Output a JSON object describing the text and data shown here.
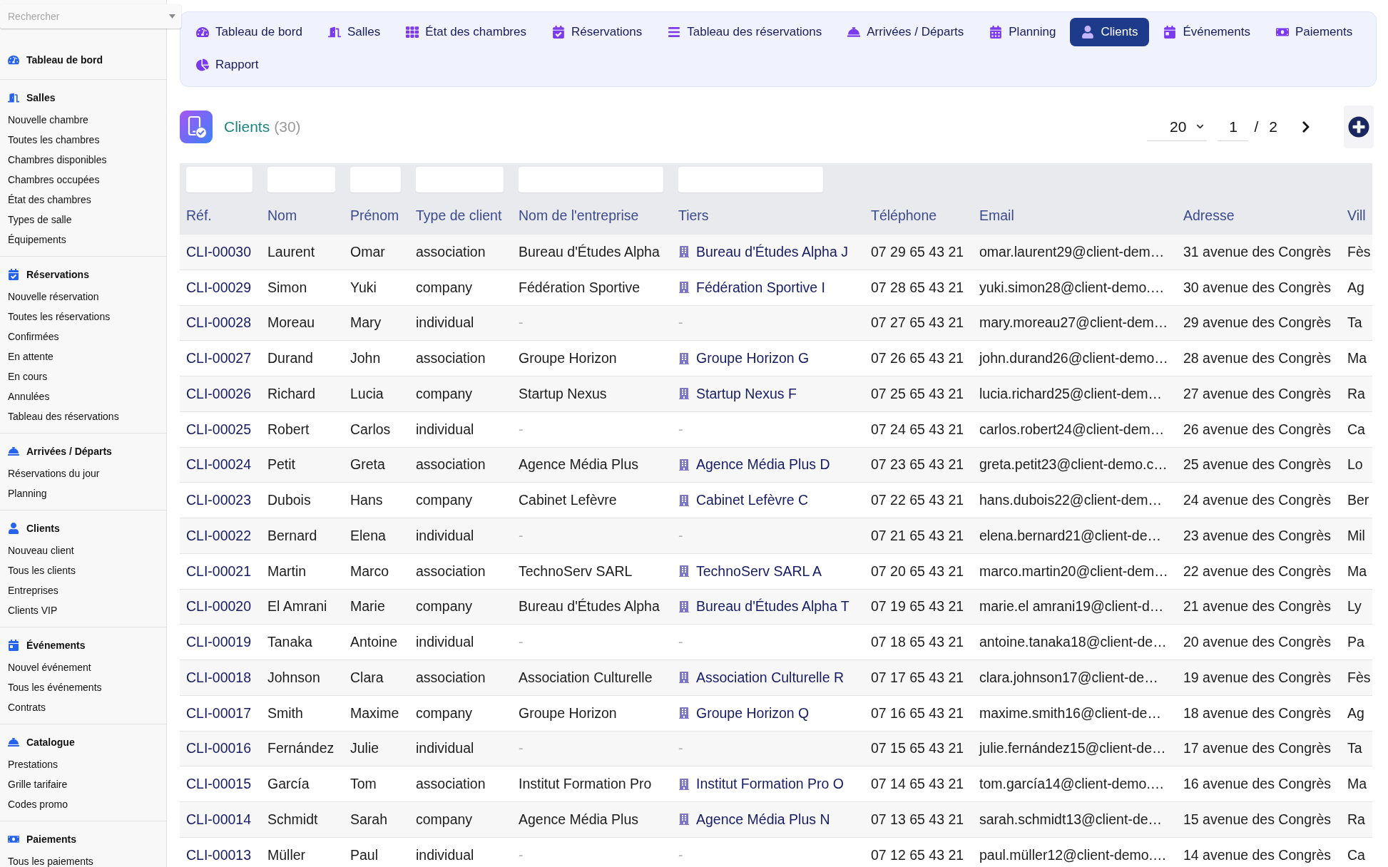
{
  "sidebar": {
    "search": {
      "placeholder": "Rechercher"
    },
    "sections": [
      {
        "title": "Tableau de bord"
      },
      {
        "title": "Salles",
        "items": [
          "Nouvelle chambre",
          "Toutes les chambres",
          "Chambres disponibles",
          "Chambres occupées",
          "État des chambres",
          "Types de salle",
          "Équipements"
        ]
      },
      {
        "title": "Réservations",
        "items": [
          "Nouvelle réservation",
          "Toutes les réservations",
          "Confirmées",
          "En attente",
          "En cours",
          "Annulées",
          "Tableau des réservations"
        ]
      },
      {
        "title": "Arrivées / Départs",
        "items": [
          "Réservations du jour",
          "Planning"
        ]
      },
      {
        "title": "Clients",
        "items": [
          "Nouveau client",
          "Tous les clients",
          "Entreprises",
          "Clients VIP"
        ]
      },
      {
        "title": "Événements",
        "items": [
          "Nouvel événement",
          "Tous les événements",
          "Contrats"
        ]
      },
      {
        "title": "Catalogue",
        "items": [
          "Prestations",
          "Grille tarifaire",
          "Codes promo"
        ]
      },
      {
        "title": "Paiements",
        "items": [
          "Tous les paiements"
        ]
      }
    ]
  },
  "nav": {
    "items": [
      {
        "label": "Tableau de bord",
        "selected": false
      },
      {
        "label": "Salles",
        "selected": false
      },
      {
        "label": "État des chambres",
        "selected": false
      },
      {
        "label": "Réservations",
        "selected": false
      },
      {
        "label": "Tableau des réservations",
        "selected": false
      },
      {
        "label": "Arrivées / Départs",
        "selected": false
      },
      {
        "label": "Planning",
        "selected": false
      },
      {
        "label": "Clients",
        "selected": true
      },
      {
        "label": "Événements",
        "selected": false
      },
      {
        "label": "Paiements",
        "selected": false
      },
      {
        "label": "Rapport",
        "selected": false
      }
    ]
  },
  "header": {
    "title": "Clients",
    "count": "(30)"
  },
  "pagination": {
    "page_size": "20",
    "page": "1",
    "separator": "/",
    "total_pages": "2"
  },
  "table": {
    "columns": [
      {
        "label": "Réf.",
        "filter": true
      },
      {
        "label": "Nom",
        "filter": true
      },
      {
        "label": "Prénom",
        "filter": true
      },
      {
        "label": "Type de client",
        "filter": true
      },
      {
        "label": "Nom de l'entreprise",
        "filter": true
      },
      {
        "label": "Tiers",
        "filter": true
      },
      {
        "label": "Téléphone",
        "filter": false
      },
      {
        "label": "Email",
        "filter": false
      },
      {
        "label": "Adresse",
        "filter": false
      },
      {
        "label": "Vill",
        "filter": false
      }
    ],
    "rows": [
      {
        "ref": "CLI-00030",
        "nom": "Laurent",
        "prenom": "Omar",
        "type_de_client": "association",
        "nom_entreprise": "Bureau d'Études Alpha",
        "tiers": "Bureau d'Études Alpha J",
        "company_linked": true,
        "telephone": "07 29 65 43 21",
        "email": "omar.laurent29@client-dem…",
        "adresse": "31 avenue des Congrès",
        "column_10": "Fès"
      },
      {
        "ref": "CLI-00029",
        "nom": "Simon",
        "prenom": "Yuki",
        "type_de_client": "company",
        "nom_entreprise": "Fédération Sportive",
        "tiers": "Fédération Sportive I",
        "company_linked": true,
        "telephone": "07 28 65 43 21",
        "email": "yuki.simon28@client-demo.…",
        "adresse": "30 avenue des Congrès",
        "column_10": "Ag"
      },
      {
        "ref": "CLI-00028",
        "nom": "Moreau",
        "prenom": "Mary",
        "type_de_client": "individual",
        "nom_entreprise": "-",
        "tiers": "-",
        "company_linked": false,
        "telephone": "07 27 65 43 21",
        "email": "mary.moreau27@client-dem…",
        "adresse": "29 avenue des Congrès",
        "column_10": "Ta"
      },
      {
        "ref": "CLI-00027",
        "nom": "Durand",
        "prenom": "John",
        "type_de_client": "association",
        "nom_entreprise": "Groupe Horizon",
        "tiers": "Groupe Horizon G",
        "company_linked": true,
        "telephone": "07 26 65 43 21",
        "email": "john.durand26@client-demo…",
        "adresse": "28 avenue des Congrès",
        "column_10": "Ma"
      },
      {
        "ref": "CLI-00026",
        "nom": "Richard",
        "prenom": "Lucia",
        "type_de_client": "company",
        "nom_entreprise": "Startup Nexus",
        "tiers": "Startup Nexus F",
        "company_linked": true,
        "telephone": "07 25 65 43 21",
        "email": "lucia.richard25@client-dem…",
        "adresse": "27 avenue des Congrès",
        "column_10": "Ra"
      },
      {
        "ref": "CLI-00025",
        "nom": "Robert",
        "prenom": "Carlos",
        "type_de_client": "individual",
        "nom_entreprise": "-",
        "tiers": "-",
        "company_linked": false,
        "telephone": "07 24 65 43 21",
        "email": "carlos.robert24@client-dem…",
        "adresse": "26 avenue des Congrès",
        "column_10": "Ca"
      },
      {
        "ref": "CLI-00024",
        "nom": "Petit",
        "prenom": "Greta",
        "type_de_client": "association",
        "nom_entreprise": "Agence Média Plus",
        "tiers": "Agence Média Plus D",
        "company_linked": true,
        "telephone": "07 23 65 43 21",
        "email": "greta.petit23@client-demo.c…",
        "adresse": "25 avenue des Congrès",
        "column_10": "Lo"
      },
      {
        "ref": "CLI-00023",
        "nom": "Dubois",
        "prenom": "Hans",
        "type_de_client": "company",
        "nom_entreprise": "Cabinet Lefèvre",
        "tiers": "Cabinet Lefèvre C",
        "company_linked": true,
        "telephone": "07 22 65 43 21",
        "email": "hans.dubois22@client-dem…",
        "adresse": "24 avenue des Congrès",
        "column_10": "Ber"
      },
      {
        "ref": "CLI-00022",
        "nom": "Bernard",
        "prenom": "Elena",
        "type_de_client": "individual",
        "nom_entreprise": "-",
        "tiers": "-",
        "company_linked": false,
        "telephone": "07 21 65 43 21",
        "email": "elena.bernard21@client-de…",
        "adresse": "23 avenue des Congrès",
        "column_10": "Mil"
      },
      {
        "ref": "CLI-00021",
        "nom": "Martin",
        "prenom": "Marco",
        "type_de_client": "association",
        "nom_entreprise": "TechnoServ SARL",
        "tiers": "TechnoServ SARL A",
        "company_linked": true,
        "telephone": "07 20 65 43 21",
        "email": "marco.martin20@client-dem…",
        "adresse": "22 avenue des Congrès",
        "column_10": "Ma"
      },
      {
        "ref": "CLI-00020",
        "nom": "El Amrani",
        "prenom": "Marie",
        "type_de_client": "company",
        "nom_entreprise": "Bureau d'Études Alpha",
        "tiers": "Bureau d'Études Alpha T",
        "company_linked": true,
        "telephone": "07 19 65 43 21",
        "email": "marie.el amrani19@client-d…",
        "adresse": "21 avenue des Congrès",
        "column_10": "Ly"
      },
      {
        "ref": "CLI-00019",
        "nom": "Tanaka",
        "prenom": "Antoine",
        "type_de_client": "individual",
        "nom_entreprise": "-",
        "tiers": "-",
        "company_linked": false,
        "telephone": "07 18 65 43 21",
        "email": "antoine.tanaka18@client-de…",
        "adresse": "20 avenue des Congrès",
        "column_10": "Pa"
      },
      {
        "ref": "CLI-00018",
        "nom": "Johnson",
        "prenom": "Clara",
        "type_de_client": "association",
        "nom_entreprise": "Association Culturelle",
        "tiers": "Association Culturelle R",
        "company_linked": true,
        "telephone": "07 17 65 43 21",
        "email": "clara.johnson17@client-de…",
        "adresse": "19 avenue des Congrès",
        "column_10": "Fès"
      },
      {
        "ref": "CLI-00017",
        "nom": "Smith",
        "prenom": "Maxime",
        "type_de_client": "company",
        "nom_entreprise": "Groupe Horizon",
        "tiers": "Groupe Horizon Q",
        "company_linked": true,
        "telephone": "07 16 65 43 21",
        "email": "maxime.smith16@client-de…",
        "adresse": "18 avenue des Congrès",
        "column_10": "Ag"
      },
      {
        "ref": "CLI-00016",
        "nom": "Fernández",
        "prenom": "Julie",
        "type_de_client": "individual",
        "nom_entreprise": "-",
        "tiers": "-",
        "company_linked": false,
        "telephone": "07 15 65 43 21",
        "email": "julie.fernández15@client-de…",
        "adresse": "17 avenue des Congrès",
        "column_10": "Ta"
      },
      {
        "ref": "CLI-00015",
        "nom": "García",
        "prenom": "Tom",
        "type_de_client": "association",
        "nom_entreprise": "Institut Formation Pro",
        "tiers": "Institut Formation Pro O",
        "company_linked": true,
        "telephone": "07 14 65 43 21",
        "email": "tom.garcía14@client-demo.…",
        "adresse": "16 avenue des Congrès",
        "column_10": "Ma"
      },
      {
        "ref": "CLI-00014",
        "nom": "Schmidt",
        "prenom": "Sarah",
        "type_de_client": "company",
        "nom_entreprise": "Agence Média Plus",
        "tiers": "Agence Média Plus N",
        "company_linked": true,
        "telephone": "07 13 65 43 21",
        "email": "sarah.schmidt13@client-de…",
        "adresse": "15 avenue des Congrès",
        "column_10": "Ra"
      },
      {
        "ref": "CLI-00013",
        "nom": "Müller",
        "prenom": "Paul",
        "type_de_client": "individual",
        "nom_entreprise": "-",
        "tiers": "-",
        "company_linked": false,
        "telephone": "07 12 65 43 21",
        "email": "paul.müller12@client-demo.…",
        "adresse": "14 avenue des Congrès",
        "column_10": "Ca"
      }
    ]
  }
}
